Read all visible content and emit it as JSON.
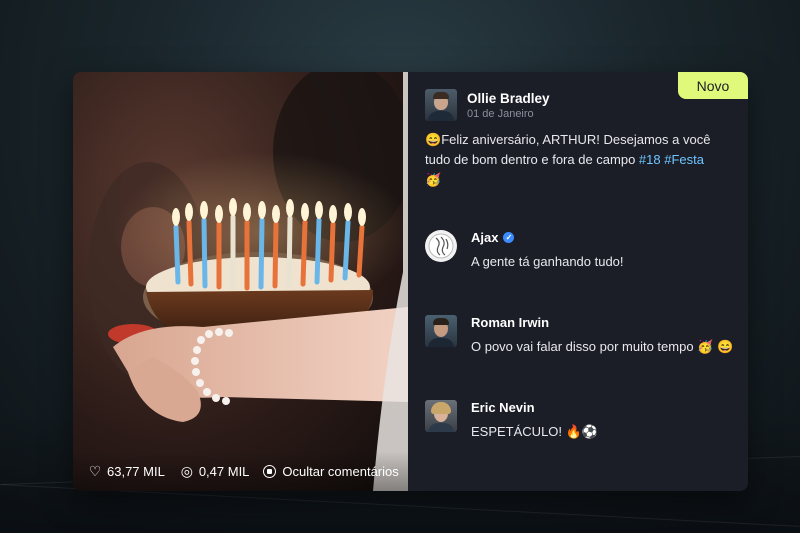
{
  "badge": "Novo",
  "post": {
    "author": "Ollie Bradley",
    "date": "01 de Janeiro",
    "caption_emoji_start": "😄",
    "caption_text": "Feliz aniversário, ARTHUR! Desejamos a você tudo de bom dentro e fora de campo ",
    "hashtag_1": "#18",
    "hashtag_2": "#Festa",
    "caption_emoji_end": "🥳"
  },
  "media": {
    "likes": "63,77 MIL",
    "comments": "0,47 MIL",
    "hide_comments": "Ocultar comentários",
    "like_icon": "heart-icon",
    "comment_icon": "comment-icon"
  },
  "comments": [
    {
      "name": "Ajax",
      "verified": true,
      "text": "A gente tá ganhando tudo!"
    },
    {
      "name": "Roman Irwin",
      "verified": false,
      "text": "O povo vai falar disso por muito tempo 🥳 😄"
    },
    {
      "name": "Eric Nevin",
      "verified": false,
      "text": "ESPETÁCULO! 🔥⚽"
    }
  ],
  "colors": {
    "badge": "#e1f97a",
    "hashtag": "#6fc6ff",
    "verified": "#3b8cff",
    "card_bg": "#1b1d27"
  }
}
